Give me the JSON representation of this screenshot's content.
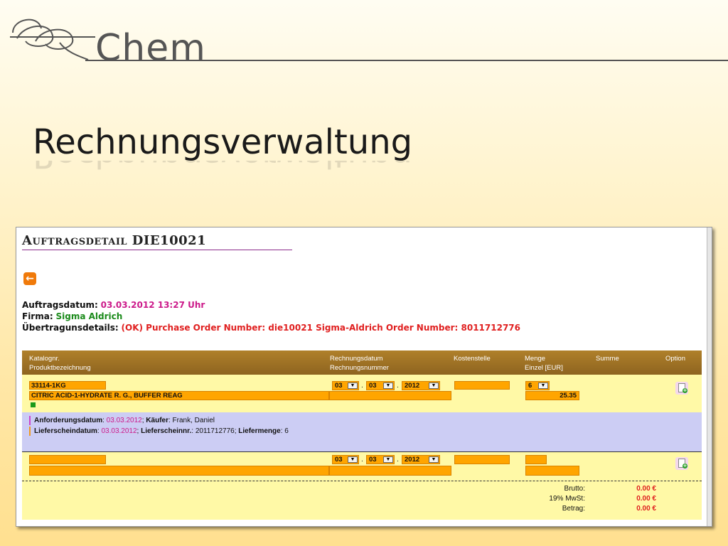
{
  "slide": {
    "logo_text": "Chem",
    "title": "Rechnungsverwaltung"
  },
  "page": {
    "heading": "Auftragsdetail DIE10021",
    "back_icon": "arrow-left-icon",
    "order_date_label": "Auftragsdatum:",
    "order_date_value": "03.03.2012 13:27 Uhr",
    "company_label": "Firma:",
    "company_value": "Sigma Aldrich",
    "transfer_label": "Übertragunsdetails:",
    "transfer_value": "(OK) Purchase Order Number: die10021 Sigma-Aldrich Order Number: 8011712776"
  },
  "table": {
    "headers": {
      "catalog": "Katalognr.",
      "product": "Produktbezeichnung",
      "invoice_date": "Rechnungsdatum",
      "invoice_number": "Rechnungsnummer",
      "cost_center": "Kostenstelle",
      "quantity": "Menge",
      "unit_price": "Einzel [EUR]",
      "sum": "Summe",
      "option": "Option"
    },
    "row1": {
      "catalog": "33114-1KG",
      "product": "CITRIC ACID-1-HYDRATE R. G., BUFFER REAG",
      "day": "03",
      "month": "03",
      "year": "2012",
      "quantity": "6",
      "unit_price": "25.35"
    },
    "details": {
      "req_date_label": "Anforderungsdatum",
      "req_date_value": "03.03.2012",
      "buyer_label": "Käufer",
      "buyer_value": "Frank, Daniel",
      "delivery_date_label": "Lieferscheindatum",
      "delivery_date_value": "03.03.2012",
      "delivery_no_label": "Lieferscheinnr.",
      "delivery_no_value": "2011712776",
      "delivery_qty_label": "Liefermenge",
      "delivery_qty_value": "6"
    },
    "row2": {
      "day": "03",
      "month": "03",
      "year": "2012"
    },
    "totals": {
      "brutto_label": "Brutto:",
      "brutto_value": "0.00 €",
      "tax_label": "19% MwSt:",
      "tax_value": "0.00 €",
      "total_label": "Betrag:",
      "total_value": "0.00 €"
    }
  },
  "colors": {
    "accent_orange": "#ffa500",
    "header_brown": "#9c7025",
    "row_yellow": "#fff9a6",
    "detail_lavender": "#cccdf4",
    "magenta": "#cc1a8a",
    "red": "#e02020",
    "green": "#1a8a1a"
  }
}
